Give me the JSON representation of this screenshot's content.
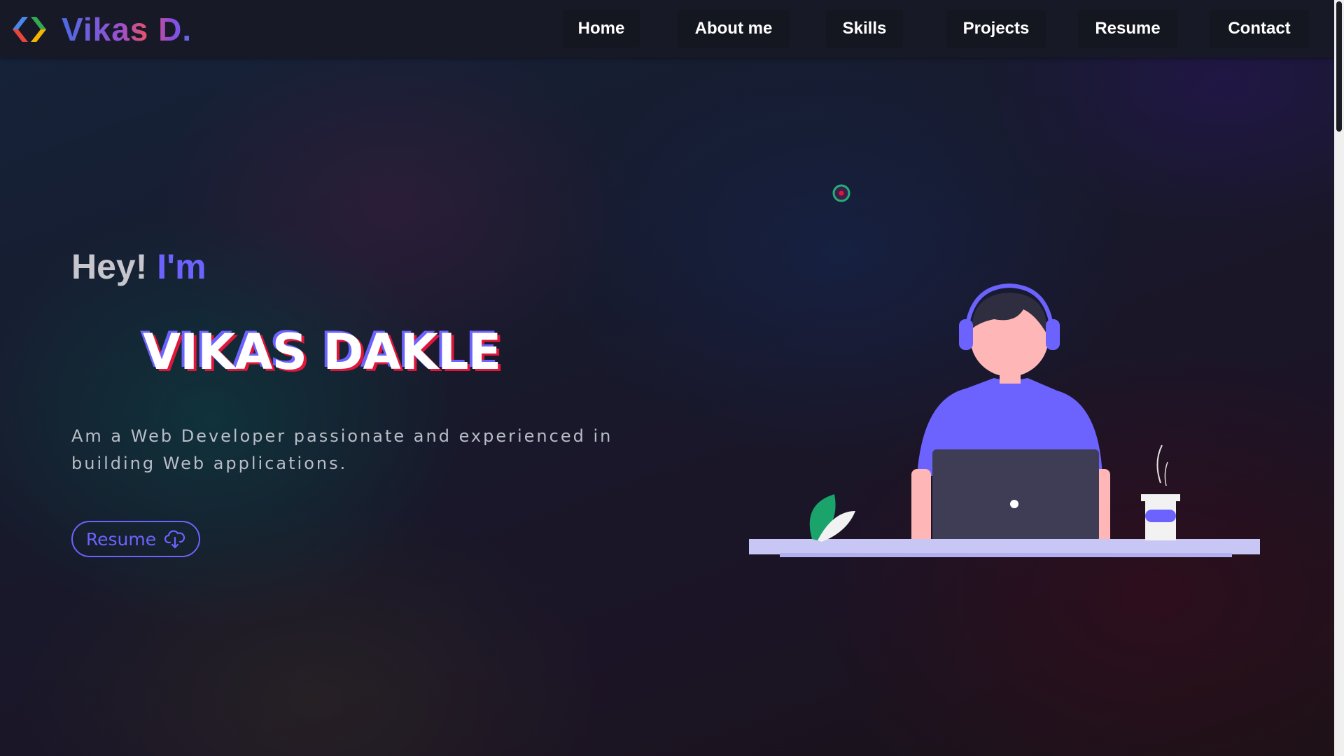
{
  "brand": {
    "name": "Vikas D.",
    "logo_icon": "code-brackets-icon"
  },
  "nav": {
    "items": [
      {
        "label": "Home"
      },
      {
        "label": "About me"
      },
      {
        "label": "Skills"
      },
      {
        "label": "Projects"
      },
      {
        "label": "Resume"
      },
      {
        "label": "Contact"
      }
    ]
  },
  "hero": {
    "greeting_prefix": "Hey!",
    "greeting_accent": "I'm",
    "name": "VIKAS DAKLE",
    "tagline": "Am a Web Developer passionate and experienced in building Web applications.",
    "resume_button": "Resume",
    "resume_icon": "cloud-download-icon"
  },
  "colors": {
    "accent": "#6c63ff",
    "name_shadow_red": "#e0163a",
    "nav_bg": "#171a26"
  }
}
